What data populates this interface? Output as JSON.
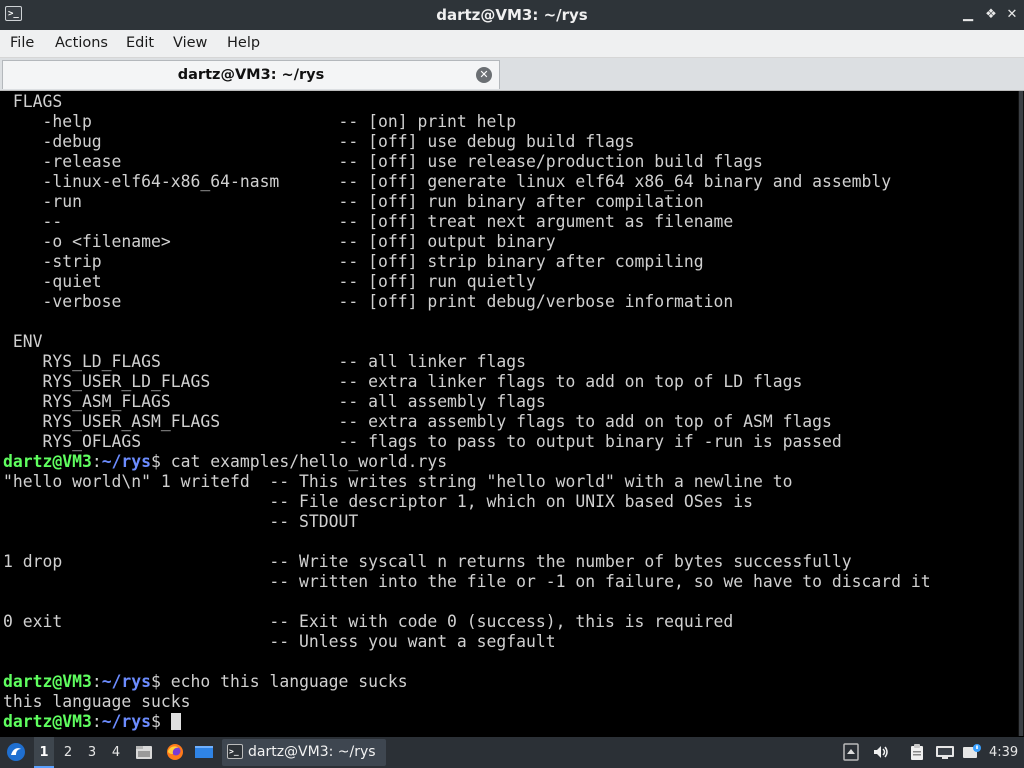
{
  "window": {
    "title": "dartz@VM3: ~/rys",
    "icon": "terminal-icon"
  },
  "menu": [
    "File",
    "Actions",
    "Edit",
    "View",
    "Help"
  ],
  "tab": {
    "label": "dartz@VM3: ~/rys",
    "close_icon": "close-circle-icon"
  },
  "prompt": {
    "user": "dartz@VM3",
    "sep": ":",
    "path": "~/rys",
    "sym": "$ "
  },
  "terminal": {
    "lines": [
      " FLAGS",
      "    -help                         -- [on] print help",
      "    -debug                        -- [off] use debug build flags",
      "    -release                      -- [off] use release/production build flags",
      "    -linux-elf64-x86_64-nasm      -- [off] generate linux elf64 x86_64 binary and assembly",
      "    -run                          -- [off] run binary after compilation",
      "    --                            -- [off] treat next argument as filename",
      "    -o <filename>                 -- [off] output binary",
      "    -strip                        -- [off] strip binary after compiling",
      "    -quiet                        -- [off] run quietly",
      "    -verbose                      -- [off] print debug/verbose information",
      "",
      " ENV",
      "    RYS_LD_FLAGS                  -- all linker flags",
      "    RYS_USER_LD_FLAGS             -- extra linker flags to add on top of LD flags",
      "    RYS_ASM_FLAGS                 -- all assembly flags",
      "    RYS_USER_ASM_FLAGS            -- extra assembly flags to add on top of ASM flags",
      "    RYS_OFLAGS                    -- flags to pass to output binary if -run is passed",
      "cat examples/hello_world.rys",
      "\"hello world\\n\" 1 writefd  -- This writes string \"hello world\" with a newline to",
      "                           -- File descriptor 1, which on UNIX based OSes is",
      "                           -- STDOUT",
      "",
      "1 drop                     -- Write syscall n returns the number of bytes successfully",
      "                           -- written into the file or -1 on failure, so we have to discard it",
      "",
      "0 exit                     -- Exit with code 0 (success), this is required",
      "                           -- Unless you want a segfault",
      "",
      "echo this language sucks",
      "this language sucks",
      ""
    ]
  },
  "taskbar": {
    "start_icon": "start-menu-icon",
    "workspaces": [
      "1",
      "2",
      "3",
      "4"
    ],
    "active_workspace": "1",
    "launchers": [
      "file-manager-icon",
      "firefox-icon",
      "show-desktop-icon"
    ],
    "task": {
      "label": "dartz@VM3: ~/rys",
      "icon": "terminal-icon"
    },
    "tray": [
      "tray-arrow-icon",
      "volume-icon",
      "clipboard-icon",
      "network-icon",
      "update-icon"
    ],
    "clock": "4:39"
  }
}
